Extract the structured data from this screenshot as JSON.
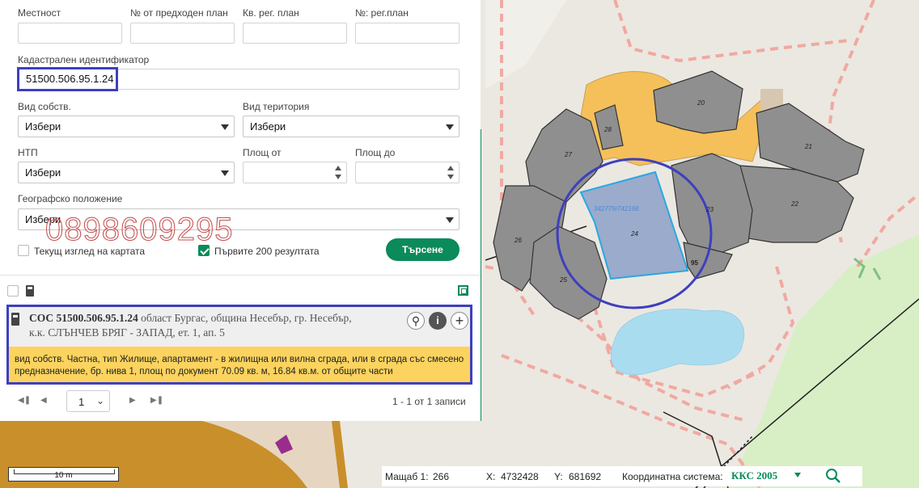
{
  "form": {
    "mestnost_label": "Местност",
    "prev_plan_label": "№ от предходен план",
    "kv_reg_label": "Кв. рег. план",
    "nr_reg_label": "№: рег.план",
    "cadastral_label": "Кадастрален идентификатор",
    "cadastral_value": "51500.506.95.1.24",
    "ownership_label": "Вид собств.",
    "ownership_value": "Избери",
    "territory_label": "Вид територия",
    "territory_value": "Избери",
    "ntp_label": "НТП",
    "ntp_value": "Избери",
    "area_from_label": "Площ от",
    "area_to_label": "Площ до",
    "geo_label": "Географско положение",
    "geo_value": "Избери",
    "current_view_label": "Текущ изглед на картата",
    "first200_label": "Първите 200 резултата",
    "search_button": "Търсене"
  },
  "watermark": "0898609295",
  "result": {
    "title_bold": "СОС 51500.506.95.1.24",
    "title_rest": " област Бургас, община Несебър, гр. Несебър,",
    "title_line2": "к.к. СЛЪНЧЕВ БРЯГ - ЗАПАД, ет. 1, ап. 5",
    "details_line1": "вид собств. Частна, тип Жилище, апартамент - в жилищна или вилна сграда, или в сграда със смесено",
    "details_line2": "предназначение, бр. нива 1, площ по документ 70.09 кв. м, 16.84 кв.м. от общите части"
  },
  "pagination": {
    "page": "1",
    "records": "1 - 1 от 1 записи"
  },
  "map": {
    "labels": {
      "b20": "20",
      "b21": "21",
      "b22": "22",
      "b23": "23",
      "b24": "24",
      "b25": "25",
      "b26": "26",
      "b27": "27",
      "b28": "28",
      "b95": "95",
      "coords": "342779/742168"
    },
    "scale_label": "10 m"
  },
  "status": {
    "scale_label": "Мащаб 1:",
    "scale_value": "266",
    "x_label": "X:",
    "x_value": "4732428",
    "y_label": "Y:",
    "y_value": "681692",
    "crs_label": "Координатна система:",
    "crs_value": "ККС 2005"
  },
  "colors": {
    "accent": "#0b8a5a",
    "highlight_border": "#3d3fbf",
    "result_details_bg": "#fbd35e",
    "building": "#8f8f8f",
    "yard": "#f5c05a"
  }
}
